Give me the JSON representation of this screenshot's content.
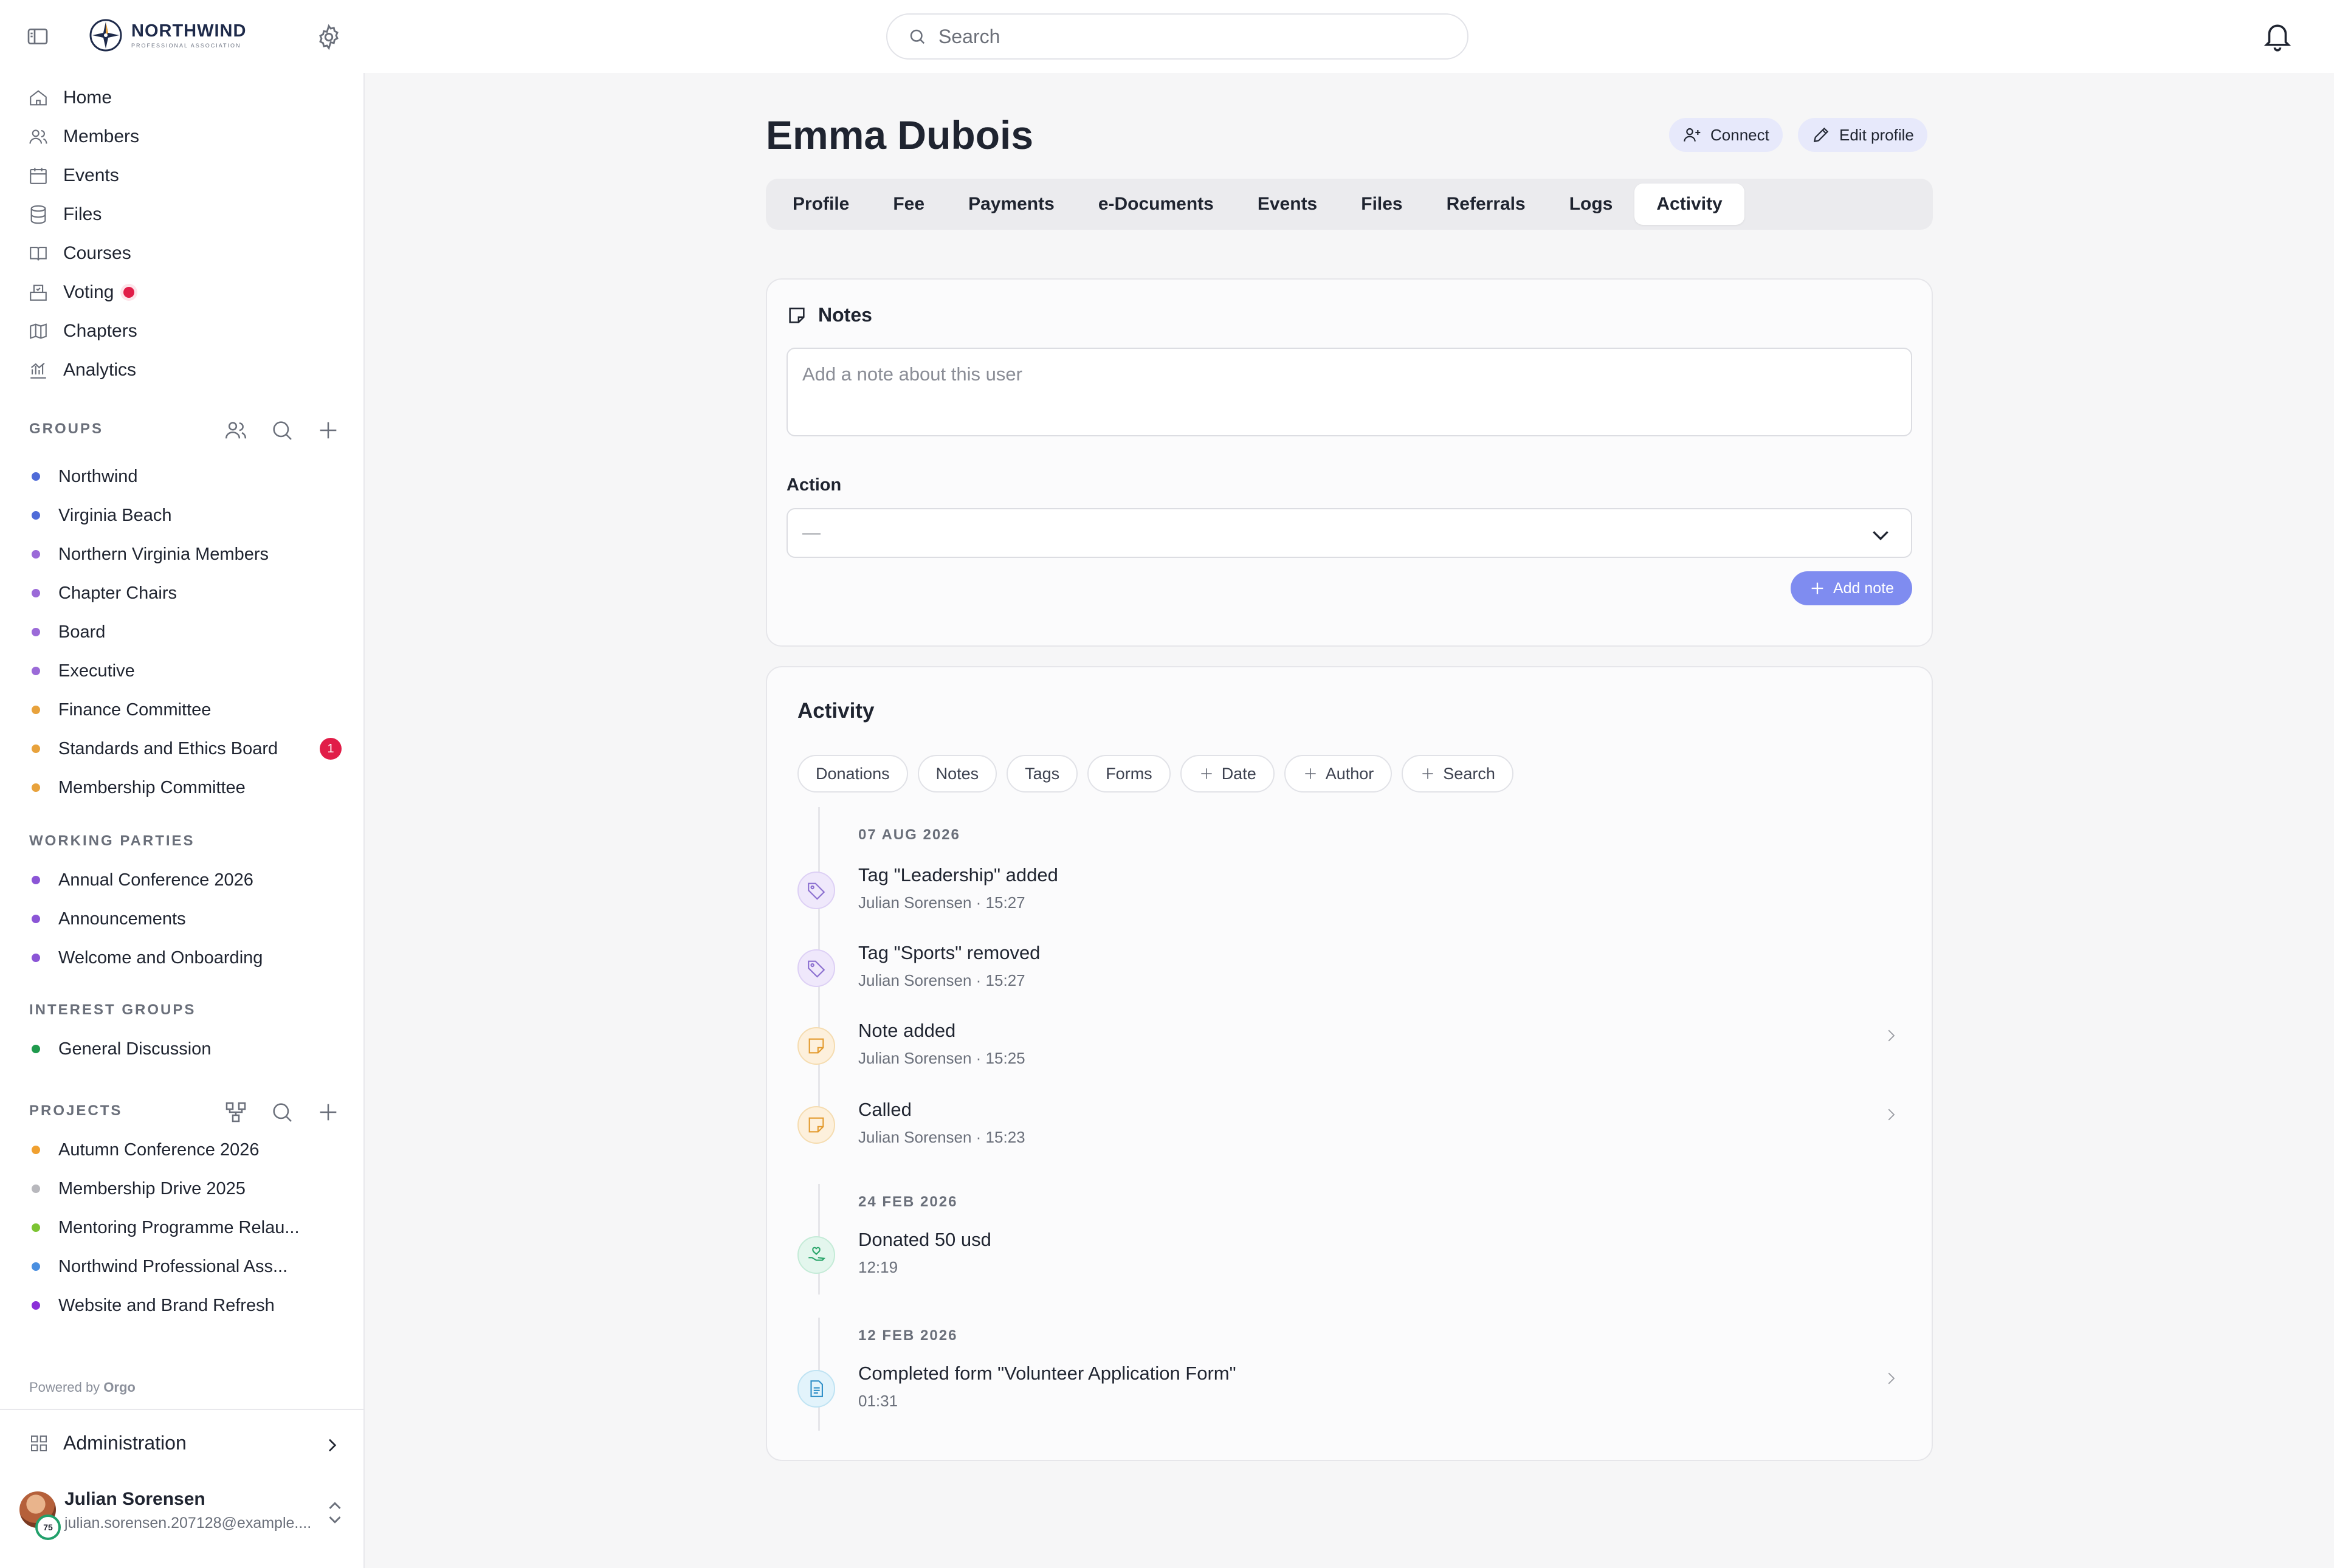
{
  "app": {
    "logo_title": "NORTHWIND",
    "logo_subtitle": "PROFESSIONAL ASSOCIATION",
    "search_placeholder": "Search"
  },
  "sidebar": {
    "nav": [
      {
        "label": "Home",
        "icon": "home-icon"
      },
      {
        "label": "Members",
        "icon": "users-icon"
      },
      {
        "label": "Events",
        "icon": "calendar-icon"
      },
      {
        "label": "Files",
        "icon": "database-icon"
      },
      {
        "label": "Courses",
        "icon": "book-icon"
      },
      {
        "label": "Voting",
        "icon": "ballot-icon"
      },
      {
        "label": "Chapters",
        "icon": "map-icon"
      },
      {
        "label": "Analytics",
        "icon": "chart-icon"
      }
    ],
    "groups_label": "GROUPS",
    "groups": [
      {
        "label": "Northwind",
        "color": "#4f6bd8"
      },
      {
        "label": "Virginia Beach",
        "color": "#4f6bd8"
      },
      {
        "label": "Northern Virginia Members",
        "color": "#9b6ad8"
      },
      {
        "label": "Chapter Chairs",
        "color": "#9b6ad8"
      },
      {
        "label": "Board",
        "color": "#9b6ad8"
      },
      {
        "label": "Executive",
        "color": "#9b6ad8"
      },
      {
        "label": "Finance Committee",
        "color": "#e8a23c"
      },
      {
        "label": "Standards and Ethics Board",
        "color": "#e8a23c",
        "badge": "1"
      },
      {
        "label": "Membership Committee",
        "color": "#e8a23c"
      }
    ],
    "working_parties_label": "WORKING PARTIES",
    "working_parties": [
      {
        "label": "Annual Conference 2026",
        "color": "#8b55d6"
      },
      {
        "label": "Announcements",
        "color": "#8b55d6"
      },
      {
        "label": "Welcome and Onboarding",
        "color": "#8b55d6"
      }
    ],
    "interest_groups_label": "INTEREST GROUPS",
    "interest_groups": [
      {
        "label": "General Discussion",
        "color": "#1f9a4d"
      }
    ],
    "projects_label": "PROJECTS",
    "projects": [
      {
        "label": "Autumn Conference 2026",
        "color": "#f0a030"
      },
      {
        "label": "Membership Drive 2025",
        "color": "#b8b8bd"
      },
      {
        "label": "Mentoring Programme Relau...",
        "color": "#7cc432"
      },
      {
        "label": "Northwind Professional Ass...",
        "color": "#4a8fe0"
      },
      {
        "label": "Website and Brand Refresh",
        "color": "#8b2fd8"
      }
    ],
    "powered_by": "Powered by",
    "powered_brand": "Orgo",
    "administration": "Administration",
    "user": {
      "name": "Julian Sorensen",
      "email": "julian.sorensen.207128@example....",
      "score": "75"
    }
  },
  "profile": {
    "name": "Emma Dubois",
    "connect_label": "Connect",
    "edit_label": "Edit profile",
    "tabs": [
      "Profile",
      "Fee",
      "Payments",
      "e-Documents",
      "Events",
      "Files",
      "Referrals",
      "Logs",
      "Activity"
    ],
    "active_tab": "Activity"
  },
  "notes": {
    "title": "Notes",
    "placeholder": "Add a note about this user",
    "action_label": "Action",
    "action_value": "—",
    "add_label": "Add note"
  },
  "activity": {
    "title": "Activity",
    "filters": [
      "Donations",
      "Notes",
      "Tags",
      "Forms"
    ],
    "add_filters": [
      "Date",
      "Author",
      "Search"
    ],
    "groups": [
      {
        "date": "07 AUG 2026",
        "events": [
          {
            "type": "tag",
            "title": "Tag \"Leadership\" added",
            "meta": "Julian Sorensen · 15:27"
          },
          {
            "type": "tag",
            "title": "Tag \"Sports\" removed",
            "meta": "Julian Sorensen · 15:27"
          },
          {
            "type": "note",
            "title": "Note added",
            "meta": "Julian Sorensen · 15:25"
          },
          {
            "type": "note",
            "title": "Called",
            "meta": "Julian Sorensen · 15:23"
          }
        ]
      },
      {
        "date": "24 FEB 2026",
        "events": [
          {
            "type": "donation",
            "title": "Donated 50 usd",
            "meta": "12:19"
          }
        ]
      },
      {
        "date": "12 FEB 2026",
        "events": [
          {
            "type": "form",
            "title": "Completed form \"Volunteer Application Form\"",
            "meta": "01:31"
          }
        ]
      }
    ]
  }
}
